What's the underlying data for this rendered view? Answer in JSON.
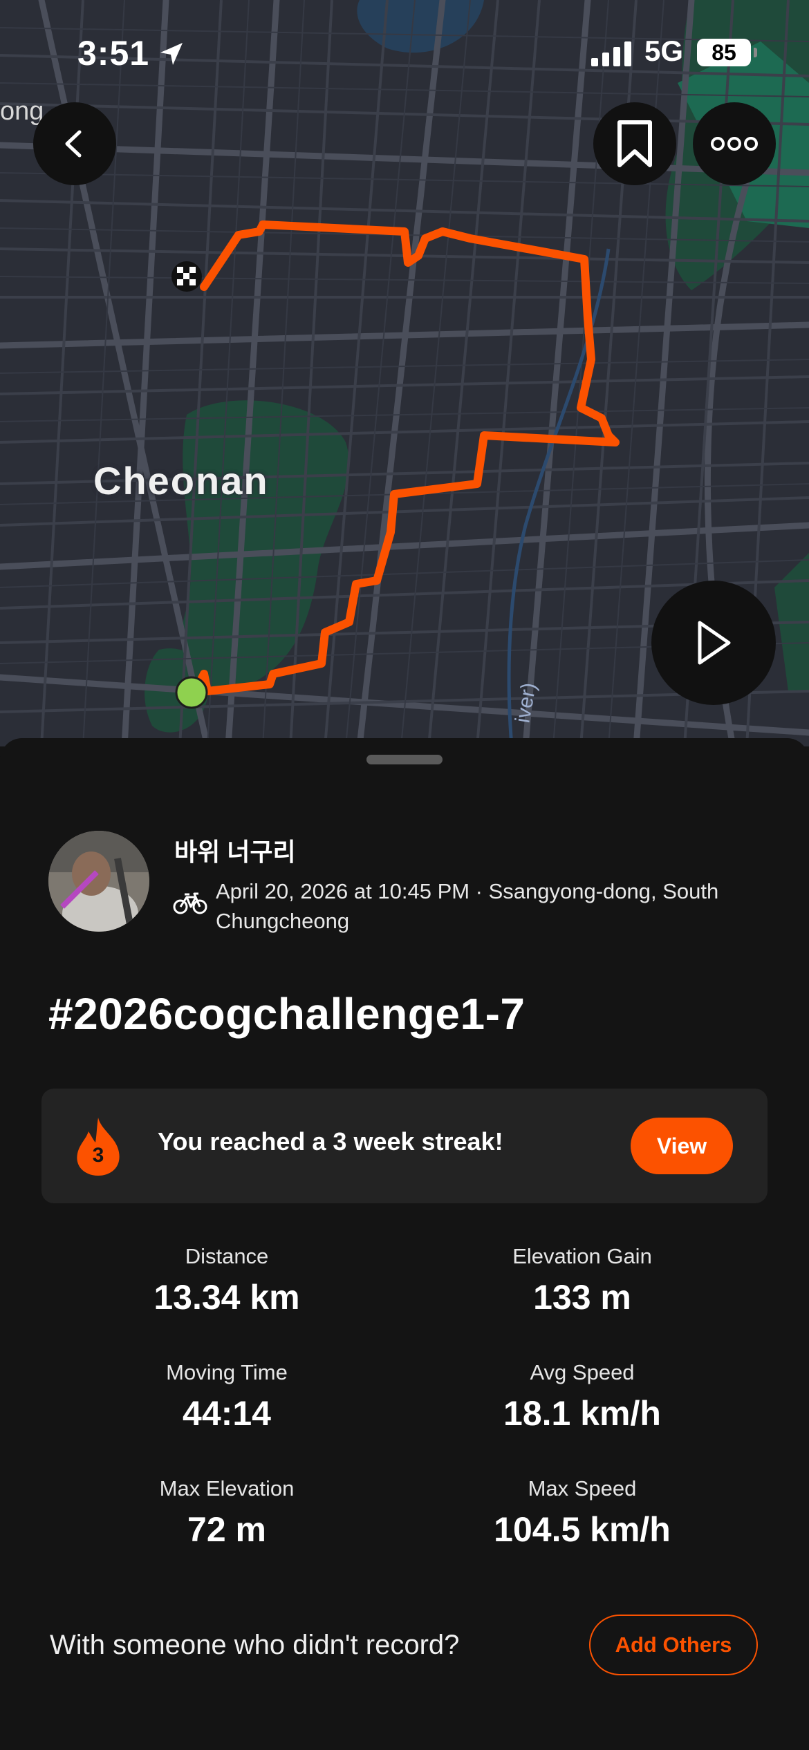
{
  "status_bar": {
    "time": "3:51",
    "network": "5G",
    "battery": "85"
  },
  "map": {
    "city_label": "Cheonan",
    "edge_label": "ong",
    "river_label": "iver)",
    "route_color": "#fc5200"
  },
  "buttons": {
    "back_icon": "chevron-left-icon",
    "bookmark_icon": "bookmark-icon",
    "more_icon": "more-icon",
    "play_icon": "play-icon"
  },
  "activity": {
    "athlete_name": "바위 너구리",
    "activity_type_icon": "bike-icon",
    "meta": "April 20, 2026 at 10:45 PM · Ssangyong-dong, South Chungcheong",
    "title": "#2026cogchallenge1-7"
  },
  "streak": {
    "count": "3",
    "text": "You reached a 3 week streak!",
    "view_label": "View"
  },
  "stats": {
    "distance": {
      "label": "Distance",
      "value": "13.34 km"
    },
    "elevation_gain": {
      "label": "Elevation Gain",
      "value": "133 m"
    },
    "moving_time": {
      "label": "Moving Time",
      "value": "44:14"
    },
    "avg_speed": {
      "label": "Avg Speed",
      "value": "18.1 km/h"
    },
    "max_elevation": {
      "label": "Max Elevation",
      "value": "72 m"
    },
    "max_speed": {
      "label": "Max Speed",
      "value": "104.5 km/h"
    }
  },
  "together": {
    "prompt": "With someone who didn't record?",
    "button_label": "Add Others"
  },
  "colors": {
    "accent": "#fc5200",
    "background": "#141414",
    "card": "#232323",
    "map_bg": "#2b2e37",
    "start_marker": "#8fd14f"
  }
}
